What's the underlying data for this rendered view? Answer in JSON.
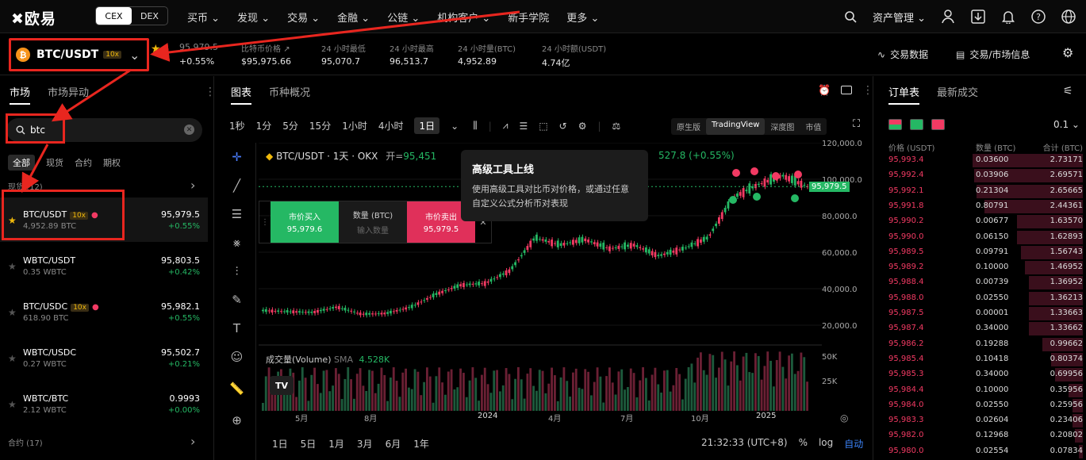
{
  "nav": {
    "logo": "欧易",
    "cex": "CEX",
    "dex": "DEX",
    "menu": [
      "买币",
      "发现",
      "交易",
      "金融",
      "公链",
      "机构客户",
      "新手学院",
      "更多"
    ],
    "asset": "资产管理"
  },
  "ticker": {
    "pair": "BTC/USDT",
    "leverage": "10x",
    "price": "95,979.5",
    "change": "+0.55%",
    "stats": [
      {
        "label": "比特币价格",
        "value": "$95,975.66"
      },
      {
        "label": "24 小时最低",
        "value": "95,070.7"
      },
      {
        "label": "24 小时最高",
        "value": "96,513.7"
      },
      {
        "label": "24 小时量(BTC)",
        "value": "4,952.89"
      },
      {
        "label": "24 小时额(USDT)",
        "value": "4.74亿"
      }
    ],
    "trade_data": "交易数据",
    "market_info": "交易/市场信息"
  },
  "left": {
    "tab_market": "市场",
    "tab_moves": "市场异动",
    "search_value": "btc",
    "filters": [
      "全部",
      "现货",
      "合约",
      "期权"
    ],
    "spot_header": "现货 (12)",
    "futures_header": "合约 (17)",
    "rows": [
      {
        "name": "BTC/USDT",
        "lev": "10x",
        "vol": "4,952.89 BTC",
        "price": "95,979.5",
        "change": "+0.55%",
        "fav": true
      },
      {
        "name": "WBTC/USDT",
        "lev": "",
        "vol": "0.35 WBTC",
        "price": "95,803.5",
        "change": "+0.42%",
        "fav": false
      },
      {
        "name": "BTC/USDC",
        "lev": "10x",
        "vol": "618.90 BTC",
        "price": "95,982.1",
        "change": "+0.55%",
        "fav": false
      },
      {
        "name": "WBTC/USDC",
        "lev": "",
        "vol": "0.27 WBTC",
        "price": "95,502.7",
        "change": "+0.21%",
        "fav": false
      },
      {
        "name": "WBTC/BTC",
        "lev": "",
        "vol": "2.12 WBTC",
        "price": "0.9993",
        "change": "+0.00%",
        "fav": false
      }
    ]
  },
  "chart": {
    "tab_chart": "图表",
    "tab_overview": "币种概况",
    "timeframes": [
      "1秒",
      "1分",
      "5分",
      "15分",
      "1小时",
      "4小时",
      "1日"
    ],
    "views": [
      "原生版",
      "TradingView",
      "深度图",
      "市值"
    ],
    "legend_pair": "BTC/USDT · 1天 · OKX",
    "legend_open_label": "开=",
    "legend_open": "95,451",
    "legend_change": "527.8 (+0.55%)",
    "tooltip_title": "高级工具上线",
    "tooltip_desc": "使用高级工具对比币对价格，或通过任意自定义公式分析币对表现",
    "buy_label": "市价买入",
    "buy_price": "95,979.6",
    "qty_label": "数量 (BTC)",
    "qty_placeholder": "输入数量",
    "sell_label": "市价卖出",
    "sell_price": "95,979.5",
    "volume_label": "成交量(Volume)",
    "volume_sma": "SMA",
    "volume_val": "4.528K",
    "time": "21:32:33 (UTC+8)",
    "ranges": [
      "1日",
      "5日",
      "1月",
      "3月",
      "6月",
      "1年"
    ],
    "pct": "%",
    "log": "log",
    "auto": "自动"
  },
  "chart_data": {
    "type": "line",
    "y_ticks": [
      "120,000.0",
      "100,000.0",
      "80,000.0",
      "60,000.0",
      "40,000.0",
      "20,000.0"
    ],
    "x_ticks": [
      "5月",
      "8月",
      "2024",
      "4月",
      "7月",
      "10月",
      "2025"
    ],
    "vol_ticks": [
      "50K",
      "25K"
    ],
    "current_price": "95,979.5",
    "ylim": [
      0,
      120000
    ],
    "points": [
      [
        "2023-04",
        28000
      ],
      [
        "2023-05",
        27500
      ],
      [
        "2023-06",
        27000
      ],
      [
        "2023-07",
        30000
      ],
      [
        "2023-08",
        26000
      ],
      [
        "2023-09",
        26500
      ],
      [
        "2023-10",
        30000
      ],
      [
        "2023-11",
        37000
      ],
      [
        "2023-12",
        42000
      ],
      [
        "2024-01",
        43000
      ],
      [
        "2024-02",
        50000
      ],
      [
        "2024-03",
        68000
      ],
      [
        "2024-04",
        64000
      ],
      [
        "2024-05",
        67000
      ],
      [
        "2024-06",
        62000
      ],
      [
        "2024-07",
        64000
      ],
      [
        "2024-08",
        58000
      ],
      [
        "2024-09",
        62000
      ],
      [
        "2024-10",
        68000
      ],
      [
        "2024-11",
        90000
      ],
      [
        "2024-12",
        97000
      ],
      [
        "2025-01",
        102000
      ],
      [
        "2025-02",
        96000
      ]
    ]
  },
  "orderbook": {
    "tab_book": "订单表",
    "tab_trades": "最新成交",
    "precision": "0.1",
    "head_price": "价格 (USDT)",
    "head_qty": "数量 (BTC)",
    "head_total": "合计 (BTC)",
    "asks": [
      [
        "95,993.4",
        "0.03600",
        "2.73171",
        0.55
      ],
      [
        "95,992.4",
        "0.03906",
        "2.69571",
        0.54
      ],
      [
        "95,992.1",
        "0.21304",
        "2.65665",
        0.53
      ],
      [
        "95,991.8",
        "0.80791",
        "2.44361",
        0.49
      ],
      [
        "95,990.2",
        "0.00677",
        "1.63570",
        0.33
      ],
      [
        "95,990.0",
        "0.06150",
        "1.62893",
        0.33
      ],
      [
        "95,989.5",
        "0.09791",
        "1.56743",
        0.31
      ],
      [
        "95,989.2",
        "0.10000",
        "1.46952",
        0.29
      ],
      [
        "95,988.4",
        "0.00739",
        "1.36952",
        0.27
      ],
      [
        "95,988.0",
        "0.02550",
        "1.36213",
        0.27
      ],
      [
        "95,987.5",
        "0.00001",
        "1.33663",
        0.27
      ],
      [
        "95,987.4",
        "0.34000",
        "1.33662",
        0.27
      ],
      [
        "95,986.2",
        "0.19288",
        "0.99662",
        0.2
      ],
      [
        "95,985.4",
        "0.10418",
        "0.80374",
        0.16
      ],
      [
        "95,985.3",
        "0.34000",
        "0.69956",
        0.14
      ],
      [
        "95,984.4",
        "0.10000",
        "0.35956",
        0.07
      ],
      [
        "95,984.0",
        "0.02550",
        "0.25956",
        0.05
      ],
      [
        "95,983.3",
        "0.02604",
        "0.23406",
        0.05
      ],
      [
        "95,982.0",
        "0.12968",
        "0.20802",
        0.04
      ],
      [
        "95,980.0",
        "0.02554",
        "0.07834",
        0.02
      ]
    ]
  }
}
